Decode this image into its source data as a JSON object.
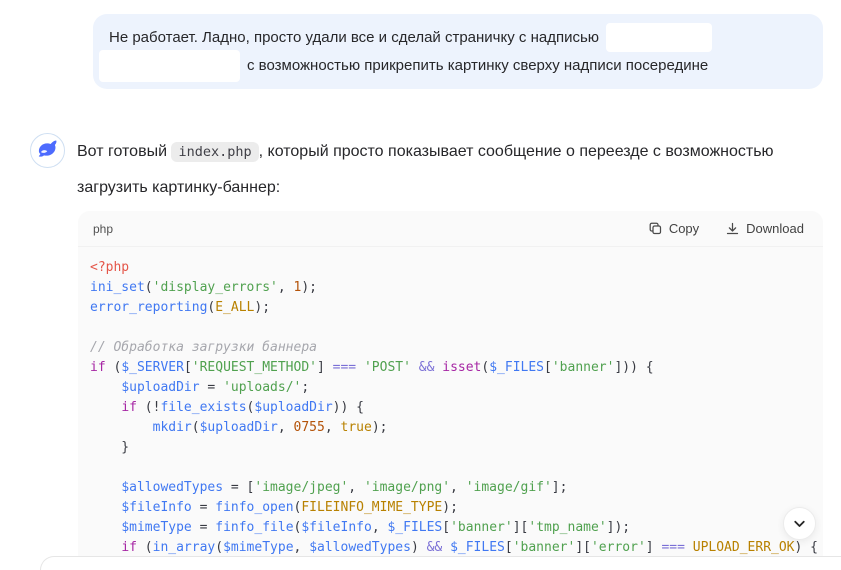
{
  "user_message": {
    "line1_text": "Не работает. Ладно, просто удали все и сделай страничку с надписью",
    "line2_text": "с возможностью прикрепить картинку сверху надписи посередине",
    "redactions": [
      "redacted-box-1",
      "redacted-box-2"
    ]
  },
  "assistant": {
    "avatar_icon": "deepseek-whale-logo",
    "message_prefix": "Вот готовый",
    "inline_code": "index.php",
    "message_suffix": ", который просто показывает сообщение о переезде с возможностью загрузить картинку-баннер:"
  },
  "code_block": {
    "language_label": "php",
    "copy_label": "Copy",
    "download_label": "Download",
    "copy_icon": "copy-icon",
    "download_icon": "download-icon",
    "lines": [
      [
        [
          "m",
          "<?php"
        ]
      ],
      [
        [
          "f",
          "ini_set"
        ],
        [
          "p",
          "("
        ],
        [
          "s",
          "'display_errors'"
        ],
        [
          "p",
          ", "
        ],
        [
          "n",
          "1"
        ],
        [
          "p",
          ");"
        ]
      ],
      [
        [
          "f",
          "error_reporting"
        ],
        [
          "p",
          "("
        ],
        [
          "c",
          "E_ALL"
        ],
        [
          "p",
          ");"
        ]
      ],
      [],
      [
        [
          "cm",
          "// Обработка загрузки баннера"
        ]
      ],
      [
        [
          "k",
          "if"
        ],
        [
          "p",
          " ("
        ],
        [
          "f",
          "$_SERVER"
        ],
        [
          "p",
          "["
        ],
        [
          "s",
          "'REQUEST_METHOD'"
        ],
        [
          "p",
          "] "
        ],
        [
          "o",
          "==="
        ],
        [
          "p",
          " "
        ],
        [
          "s",
          "'POST'"
        ],
        [
          "p",
          " "
        ],
        [
          "o",
          "&&"
        ],
        [
          "p",
          " "
        ],
        [
          "k",
          "isset"
        ],
        [
          "p",
          "("
        ],
        [
          "f",
          "$_FILES"
        ],
        [
          "p",
          "["
        ],
        [
          "s",
          "'banner'"
        ],
        [
          "p",
          "])) {"
        ]
      ],
      [
        [
          "p",
          "    "
        ],
        [
          "f",
          "$uploadDir"
        ],
        [
          "p",
          " = "
        ],
        [
          "s",
          "'uploads/'"
        ],
        [
          "p",
          ";"
        ]
      ],
      [
        [
          "p",
          "    "
        ],
        [
          "k",
          "if"
        ],
        [
          "p",
          " (!"
        ],
        [
          "f",
          "file_exists"
        ],
        [
          "p",
          "("
        ],
        [
          "f",
          "$uploadDir"
        ],
        [
          "p",
          ")) {"
        ]
      ],
      [
        [
          "p",
          "        "
        ],
        [
          "f",
          "mkdir"
        ],
        [
          "p",
          "("
        ],
        [
          "f",
          "$uploadDir"
        ],
        [
          "p",
          ", "
        ],
        [
          "n",
          "0755"
        ],
        [
          "p",
          ", "
        ],
        [
          "c",
          "true"
        ],
        [
          "p",
          ");"
        ]
      ],
      [
        [
          "p",
          "    }"
        ]
      ],
      [],
      [
        [
          "p",
          "    "
        ],
        [
          "f",
          "$allowedTypes"
        ],
        [
          "p",
          " = ["
        ],
        [
          "s",
          "'image/jpeg'"
        ],
        [
          "p",
          ", "
        ],
        [
          "s",
          "'image/png'"
        ],
        [
          "p",
          ", "
        ],
        [
          "s",
          "'image/gif'"
        ],
        [
          "p",
          "];"
        ]
      ],
      [
        [
          "p",
          "    "
        ],
        [
          "f",
          "$fileInfo"
        ],
        [
          "p",
          " = "
        ],
        [
          "f",
          "finfo_open"
        ],
        [
          "p",
          "("
        ],
        [
          "c",
          "FILEINFO_MIME_TYPE"
        ],
        [
          "p",
          ");"
        ]
      ],
      [
        [
          "p",
          "    "
        ],
        [
          "f",
          "$mimeType"
        ],
        [
          "p",
          " = "
        ],
        [
          "f",
          "finfo_file"
        ],
        [
          "p",
          "("
        ],
        [
          "f",
          "$fileInfo"
        ],
        [
          "p",
          ", "
        ],
        [
          "f",
          "$_FILES"
        ],
        [
          "p",
          "["
        ],
        [
          "s",
          "'banner'"
        ],
        [
          "p",
          "]["
        ],
        [
          "s",
          "'tmp_name'"
        ],
        [
          "p",
          "]);"
        ]
      ],
      [
        [
          "p",
          "    "
        ],
        [
          "k",
          "if"
        ],
        [
          "p",
          " ("
        ],
        [
          "f",
          "in_array"
        ],
        [
          "p",
          "("
        ],
        [
          "f",
          "$mimeType"
        ],
        [
          "p",
          ", "
        ],
        [
          "f",
          "$allowedTypes"
        ],
        [
          "p",
          ") "
        ],
        [
          "o",
          "&&"
        ],
        [
          "p",
          " "
        ],
        [
          "f",
          "$_FILES"
        ],
        [
          "p",
          "["
        ],
        [
          "s",
          "'banner'"
        ],
        [
          "p",
          "]["
        ],
        [
          "s",
          "'error'"
        ],
        [
          "p",
          "] "
        ],
        [
          "o",
          "==="
        ],
        [
          "p",
          " "
        ],
        [
          "c",
          "UPLOAD_ERR_OK"
        ],
        [
          "p",
          ") {"
        ]
      ]
    ]
  },
  "floating": {
    "scroll_down_icon": "chevron-down-icon"
  },
  "colors": {
    "bubble_bg": "#edf3fd",
    "accent_blue": "#4d6bfe",
    "code_bg": "#fafafa",
    "syntax_meta": "#e45649",
    "syntax_fn_var": "#4078f2",
    "syntax_string": "#50a14f",
    "syntax_number": "#b45309",
    "syntax_const": "#b88100",
    "syntax_keyword": "#a626a4",
    "syntax_operator": "#7a6fd6",
    "syntax_comment": "#a6a7ad",
    "syntax_plain": "#383a42"
  }
}
